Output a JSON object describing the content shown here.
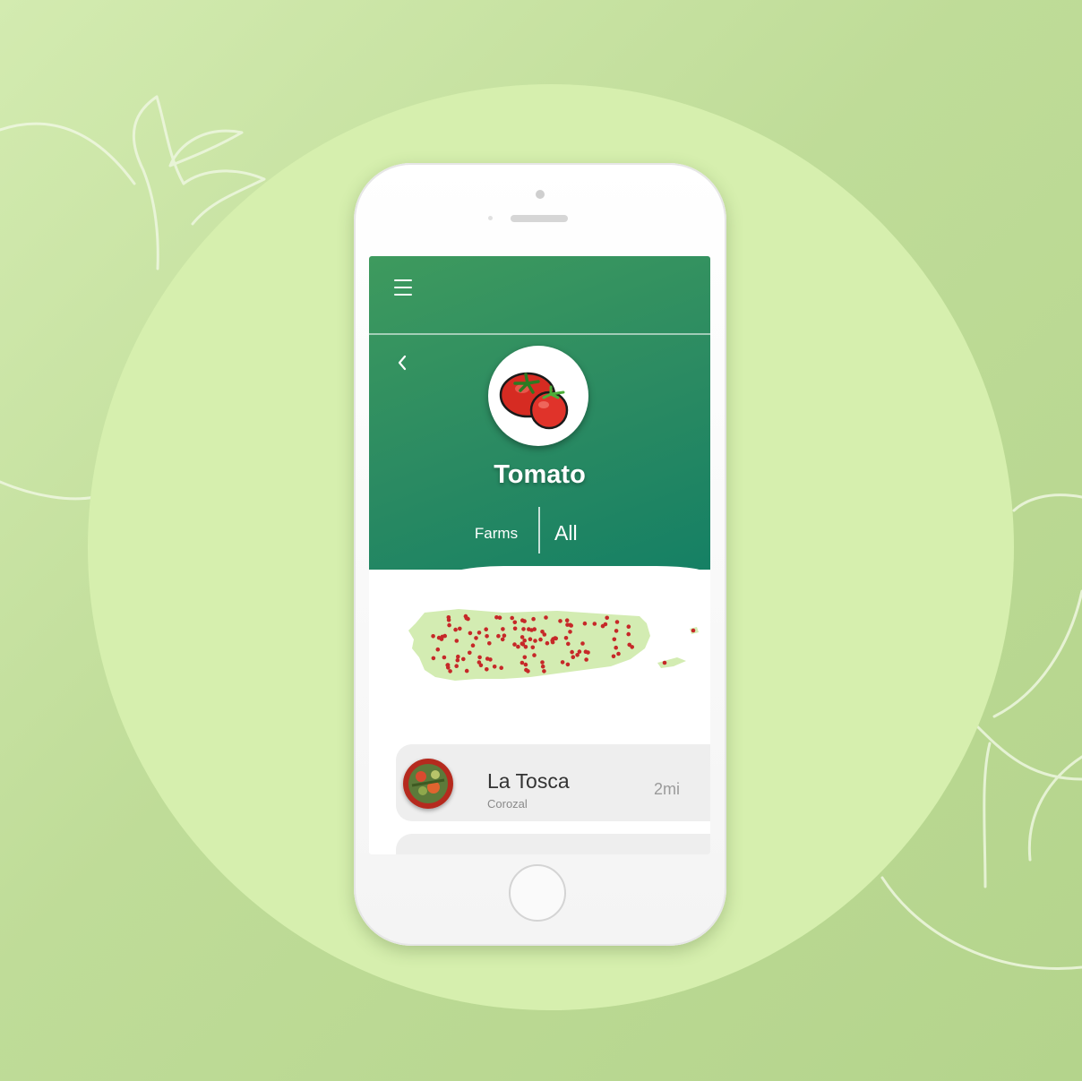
{
  "app": {
    "produce_name": "Tomato",
    "icons": {
      "menu": "hamburger-menu-icon",
      "back": "chevron-left-icon",
      "produce": "tomato-illustration-icon"
    },
    "filters": {
      "farms_label": "Farms",
      "all_label": "All"
    },
    "map": {
      "region": "Puerto Rico",
      "marker_color": "#c62828",
      "land_color": "#d3ecb2"
    },
    "farm_list": [
      {
        "name": "La Tosca",
        "location": "Corozal",
        "distance": "2mi"
      }
    ]
  },
  "colors": {
    "header_green": "#2e8c60",
    "background_green": "#cfe8a8",
    "circle_green": "#d6efae"
  }
}
